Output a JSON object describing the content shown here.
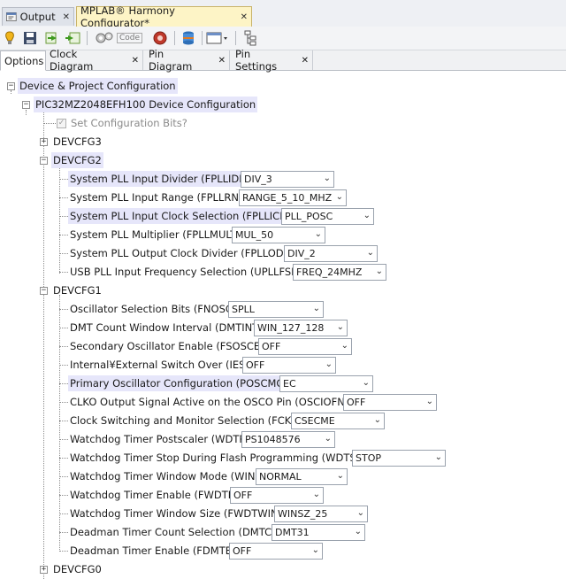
{
  "editor_tabs": [
    {
      "label": "Output",
      "close": "✕"
    },
    {
      "label": "MPLAB® Harmony Configurator*",
      "close": "✕"
    }
  ],
  "toolbar": {
    "code_label": "Code"
  },
  "view_tabs": [
    {
      "label": "Options",
      "close": ""
    },
    {
      "label": "Clock Diagram",
      "close": "✕"
    },
    {
      "label": "Pin Diagram",
      "close": "✕"
    },
    {
      "label": "Pin Settings",
      "close": "✕"
    }
  ],
  "tree": {
    "root": "Device & Project Configuration",
    "device": "PIC32MZ2048EFH100 Device Configuration",
    "set_config_bits": "Set Configuration Bits?",
    "devcfg3": "DEVCFG3",
    "devcfg2": {
      "label": "DEVCFG2",
      "rows": [
        {
          "label": "System PLL Input Divider (FPLLIDIV)",
          "value": "DIV_3"
        },
        {
          "label": "System PLL Input Range (FPLLRNG)",
          "value": "RANGE_5_10_MHZ"
        },
        {
          "label": "System PLL Input Clock Selection (FPLLICLK)",
          "value": "PLL_POSC"
        },
        {
          "label": "System PLL Multiplier (FPLLMULT)",
          "value": "MUL_50"
        },
        {
          "label": "System PLL Output Clock Divider (FPLLODIV)",
          "value": "DIV_2"
        },
        {
          "label": "USB PLL Input Frequency Selection (UPLLFSEL)",
          "value": "FREQ_24MHZ"
        }
      ]
    },
    "devcfg1": {
      "label": "DEVCFG1",
      "rows": [
        {
          "label": "Oscillator Selection Bits (FNOSC)",
          "value": "SPLL"
        },
        {
          "label": "DMT Count Window Interval (DMTINTV)",
          "value": "WIN_127_128"
        },
        {
          "label": "Secondary Oscillator Enable (FSOSCEN)",
          "value": "OFF"
        },
        {
          "label": "Internal¥External Switch Over (IESO)",
          "value": "OFF"
        },
        {
          "label": "Primary Oscillator Configuration (POSCMOD)",
          "value": "EC"
        },
        {
          "label": "CLKO Output Signal Active on the OSCO Pin (OSCIOFNC)",
          "value": "OFF"
        },
        {
          "label": "Clock Switching and Monitor Selection (FCKSM)",
          "value": "CSECME"
        },
        {
          "label": "Watchdog Timer Postscaler (WDTPS)",
          "value": "PS1048576"
        },
        {
          "label": "Watchdog Timer Stop During Flash Programming (WDTSPGM)",
          "value": "STOP"
        },
        {
          "label": "Watchdog Timer Window Mode (WINDIS)",
          "value": "NORMAL"
        },
        {
          "label": "Watchdog Timer Enable (FWDTEN)",
          "value": "OFF"
        },
        {
          "label": "Watchdog Timer Window Size (FWDTWINSZ)",
          "value": "WINSZ_25"
        },
        {
          "label": "Deadman Timer Count Selection (DMTCNT)",
          "value": "DMT31"
        },
        {
          "label": "Deadman Timer Enable (FDMTEN)",
          "value": "OFF"
        }
      ]
    },
    "devcfg0": "DEVCFG0"
  },
  "colors": {
    "highlight": "#e6e6fa",
    "active_tab": "#fdf4c6"
  }
}
